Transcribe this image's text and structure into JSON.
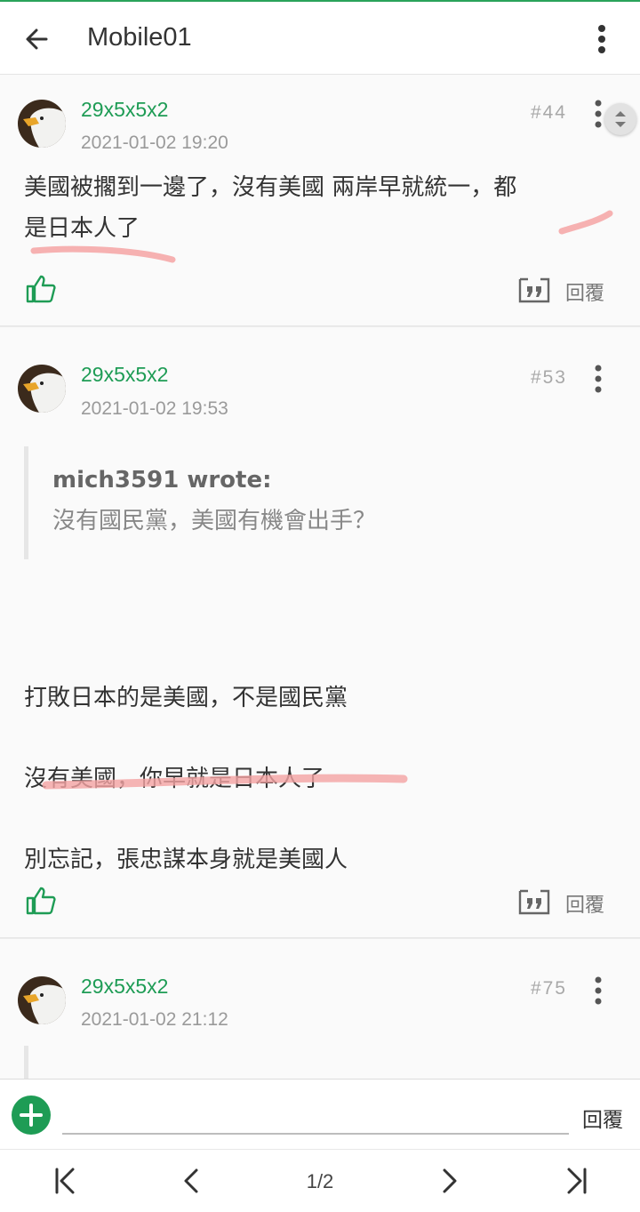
{
  "app": {
    "title": "Mobile01"
  },
  "icons": {
    "back": "arrow-left-icon",
    "more": "more-vertical-icon",
    "like": "thumbs-up-icon",
    "reply": "quote-icon",
    "add": "plus-icon",
    "scroll": "scroll-handle-icon"
  },
  "colors": {
    "accent": "#1e9c55",
    "highlight": "#f4a3a3"
  },
  "posts": [
    {
      "username": "29x5x5x2",
      "date": "2021-01-02 19:20",
      "floor": "#44",
      "lines": [
        "美國被擱到一邊了，沒有美國 兩岸早就統一，都",
        "是日本人了"
      ],
      "reply_label": "回覆"
    },
    {
      "username": "29x5x5x2",
      "date": "2021-01-02 19:53",
      "floor": "#53",
      "quote_author": "mich3591 wrote:",
      "quote_text": "沒有國民黨，美國有機會出手？",
      "lines": [
        "打敗日本的是美國，不是國民黨",
        "沒有美國，你早就是日本人了",
        "別忘記，張忠謀本身就是美國人"
      ],
      "reply_label": "回覆"
    },
    {
      "username": "29x5x5x2",
      "date": "2021-01-02 21:12",
      "floor": "#75"
    }
  ],
  "composer": {
    "placeholder": "",
    "send_label": "回覆"
  },
  "pager": {
    "page_label": "1/2",
    "current_page": 1,
    "total_pages": 2
  }
}
